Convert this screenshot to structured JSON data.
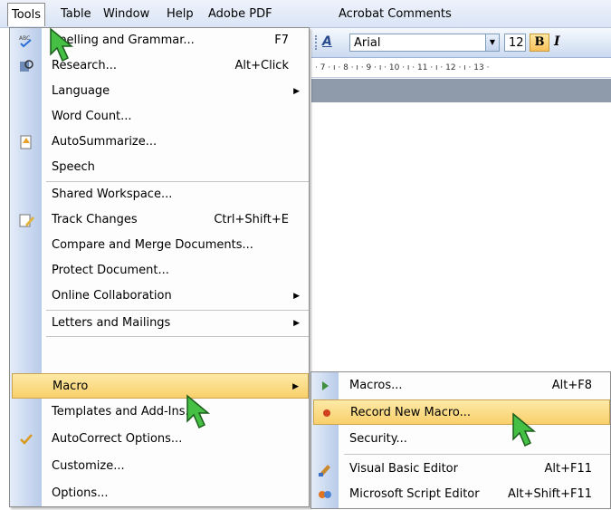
{
  "menubar": {
    "items": [
      {
        "label": "Tools",
        "active": true
      },
      {
        "label": "Table"
      },
      {
        "label": "Window"
      },
      {
        "label": "Help"
      },
      {
        "label": "Adobe PDF"
      },
      {
        "label": "Acrobat Comments"
      }
    ]
  },
  "toolbar": {
    "font_name": "Arial",
    "font_size": "12",
    "bold": "B",
    "italic": "I",
    "ruler_text": "· 7 · ı · 8 · ı · 9 · ı · 10 · ı · 11 · ı · 12 · ı · 13 ·"
  },
  "tools_menu": {
    "items": [
      {
        "label": "Spelling and Grammar...",
        "shortcut": "F7",
        "icon": "spelling-icon"
      },
      {
        "label": "Research...",
        "shortcut": "Alt+Click",
        "icon": "research-icon"
      },
      {
        "label": "Language",
        "submenu": true
      },
      {
        "label": "Word Count..."
      },
      {
        "label": "AutoSummarize...",
        "icon": "autosummarize-icon"
      },
      {
        "label": "Speech"
      },
      {
        "label": "Shared Workspace..."
      },
      {
        "label": "Track Changes",
        "shortcut": "Ctrl+Shift+E",
        "icon": "track-changes-icon"
      },
      {
        "label": "Compare and Merge Documents..."
      },
      {
        "label": "Protect Document..."
      },
      {
        "label": "Online Collaboration",
        "submenu": true
      },
      {
        "label": "Letters and Mailings",
        "submenu": true
      },
      {
        "label": "Macro",
        "submenu": true,
        "highlighted": true
      },
      {
        "label": "Templates and Add-Ins..."
      },
      {
        "label": "AutoCorrect Options...",
        "icon": "autocorrect-icon"
      },
      {
        "label": "Customize..."
      },
      {
        "label": "Options..."
      }
    ]
  },
  "macro_submenu": {
    "items": [
      {
        "label": "Macros...",
        "shortcut": "Alt+F8",
        "icon": "play-icon"
      },
      {
        "label": "Record New Macro...",
        "highlighted": true,
        "icon": "record-icon"
      },
      {
        "label": "Security..."
      },
      {
        "label": "Visual Basic Editor",
        "shortcut": "Alt+F11",
        "icon": "vb-editor-icon"
      },
      {
        "label": "Microsoft Script Editor",
        "shortcut": "Alt+Shift+F11",
        "icon": "script-editor-icon"
      }
    ]
  },
  "colors": {
    "highlight": "#f9cf6a",
    "menu_strip": "#b8cbea",
    "cursor": "#3cb43c"
  }
}
